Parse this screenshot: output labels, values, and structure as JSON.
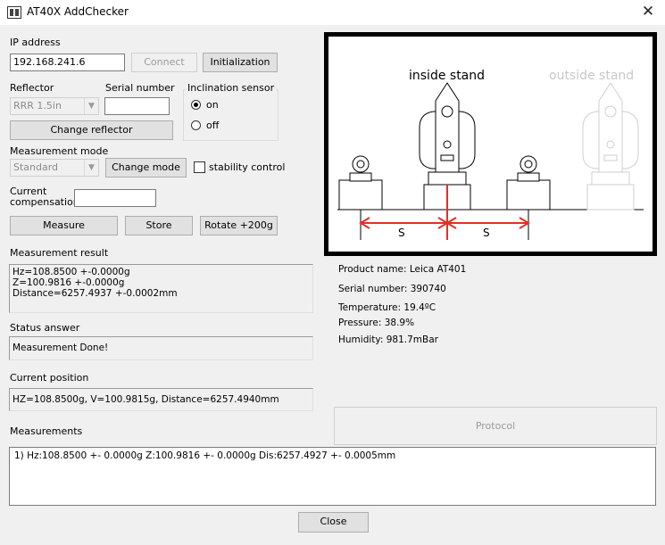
{
  "window": {
    "title": "AT40X AddChecker",
    "close_glyph": "✕"
  },
  "connection": {
    "ip_label": "IP address",
    "ip_value": "192.168.241.6",
    "connect_label": "Connect",
    "initialization_label": "Initialization"
  },
  "reflector": {
    "label": "Reflector",
    "selected": "RRR 1.5in",
    "serial_label": "Serial number",
    "serial_value": "",
    "change_label": "Change reflector"
  },
  "inclination": {
    "title": "Inclination sensor",
    "on_label": "on",
    "off_label": "off",
    "selected": "on"
  },
  "measurement_mode": {
    "label": "Measurement mode",
    "selected": "Standard",
    "change_label": "Change mode",
    "stability_label": "stability control",
    "stability_checked": false
  },
  "compensation": {
    "label_line1": "Current",
    "label_line2": "compensation",
    "value": ""
  },
  "actions": {
    "measure_label": "Measure",
    "store_label": "Store",
    "rotate_label": "Rotate +200g"
  },
  "measurement_result": {
    "label": "Measurement result",
    "text": "Hz=108.8500 +-0.0000g\nZ=100.9816 +-0.0000g\nDistance=6257.4937 +-0.0002mm"
  },
  "status": {
    "label": "Status answer",
    "text": "Measurement Done!"
  },
  "position": {
    "label": "Current position",
    "text": "HZ=108.8500g, V=100.9815g, Distance=6257.4940mm"
  },
  "diagram": {
    "inside_label": "inside stand",
    "outside_label": "outside stand",
    "s_left": "S",
    "s_right": "S",
    "accent_color": "#e0302a"
  },
  "instrument_info": {
    "product_label": "Product name:",
    "product_value": "Leica AT401",
    "serial_label": "Serial number:",
    "serial_value": "390740",
    "temperature_label": "Temperature:",
    "temperature_value": "19.4ºC",
    "pressure_label": "Pressure:",
    "pressure_value": "38.9%",
    "humidity_label": "Humidity:",
    "humidity_value": "981.7mBar"
  },
  "protocol": {
    "label": "Protocol"
  },
  "measurements": {
    "label": "Measurements",
    "items": [
      "1) Hz:108.8500 +- 0.0000g  Z:100.9816 +- 0.0000g  Dis:6257.4927 +- 0.0005mm"
    ]
  },
  "footer": {
    "close_label": "Close"
  }
}
